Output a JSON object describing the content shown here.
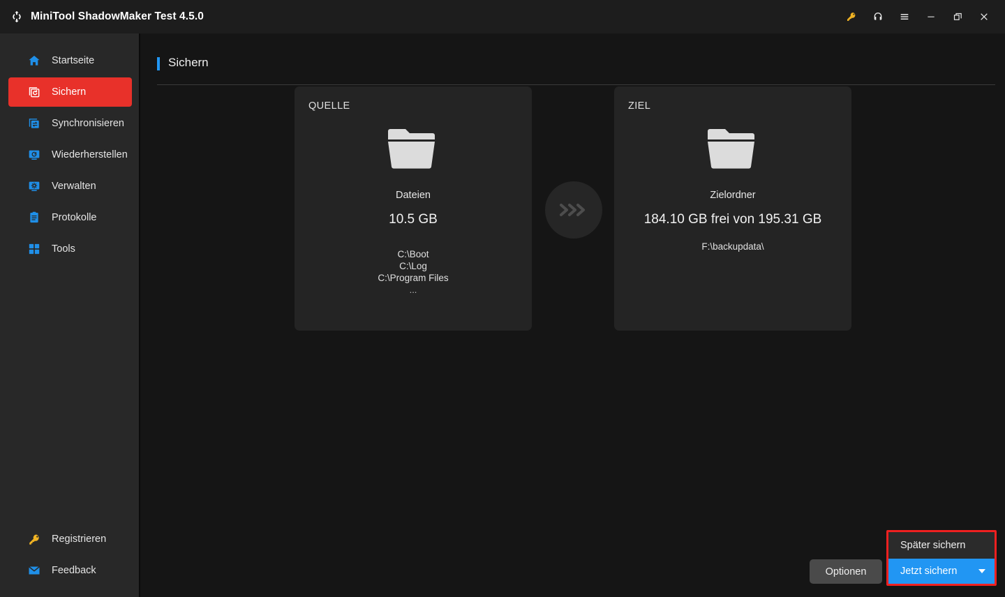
{
  "window": {
    "title": "MiniTool ShadowMaker Test 4.5.0",
    "logo_icon": "sync-circle-icon",
    "controls": [
      {
        "name": "license-key-button",
        "icon": "key-icon",
        "glyph": "key"
      },
      {
        "name": "support-button",
        "icon": "headset-icon",
        "glyph": "headset"
      },
      {
        "name": "menu-button",
        "icon": "hamburger-menu-icon",
        "glyph": "hamburger"
      },
      {
        "name": "minimize-button",
        "icon": "minimize-icon",
        "glyph": "minimize"
      },
      {
        "name": "restore-button",
        "icon": "restore-window-icon",
        "glyph": "restore"
      },
      {
        "name": "close-button",
        "icon": "close-icon",
        "glyph": "close"
      }
    ]
  },
  "sidebar": {
    "items": [
      {
        "label": "Startseite",
        "icon": "home-icon",
        "active": false
      },
      {
        "label": "Sichern",
        "icon": "backup-icon",
        "active": true
      },
      {
        "label": "Synchronisieren",
        "icon": "sync-files-icon",
        "active": false
      },
      {
        "label": "Wiederherstellen",
        "icon": "restore-monitor-icon",
        "active": false
      },
      {
        "label": "Verwalten",
        "icon": "manage-gear-monitor-icon",
        "active": false
      },
      {
        "label": "Protokolle",
        "icon": "logs-clipboard-icon",
        "active": false
      },
      {
        "label": "Tools",
        "icon": "tools-grid-icon",
        "active": false
      }
    ],
    "bottom_items": [
      {
        "label": "Registrieren",
        "icon": "key-icon"
      },
      {
        "label": "Feedback",
        "icon": "envelope-icon"
      }
    ]
  },
  "page": {
    "title": "Sichern"
  },
  "source_card": {
    "header": "QUELLE",
    "icon": "folder-icon",
    "type_label": "Dateien",
    "size": "10.5 GB",
    "paths": [
      "C:\\Boot",
      "C:\\Log",
      "C:\\Program Files"
    ],
    "more": "..."
  },
  "connector": {
    "icon": "chevrons-right-icon"
  },
  "dest_card": {
    "header": "ZIEL",
    "icon": "folder-icon",
    "type_label": "Zielordner",
    "capacity": "184.10 GB frei von 195.31 GB",
    "path": "F:\\backupdata\\"
  },
  "actions": {
    "options_label": "Optionen",
    "backup_later_label": "Später sichern",
    "backup_now_label": "Jetzt sichern",
    "dropdown_icon": "caret-down-icon",
    "highlight_color": "#ef2020",
    "primary_color": "#2196f3"
  }
}
